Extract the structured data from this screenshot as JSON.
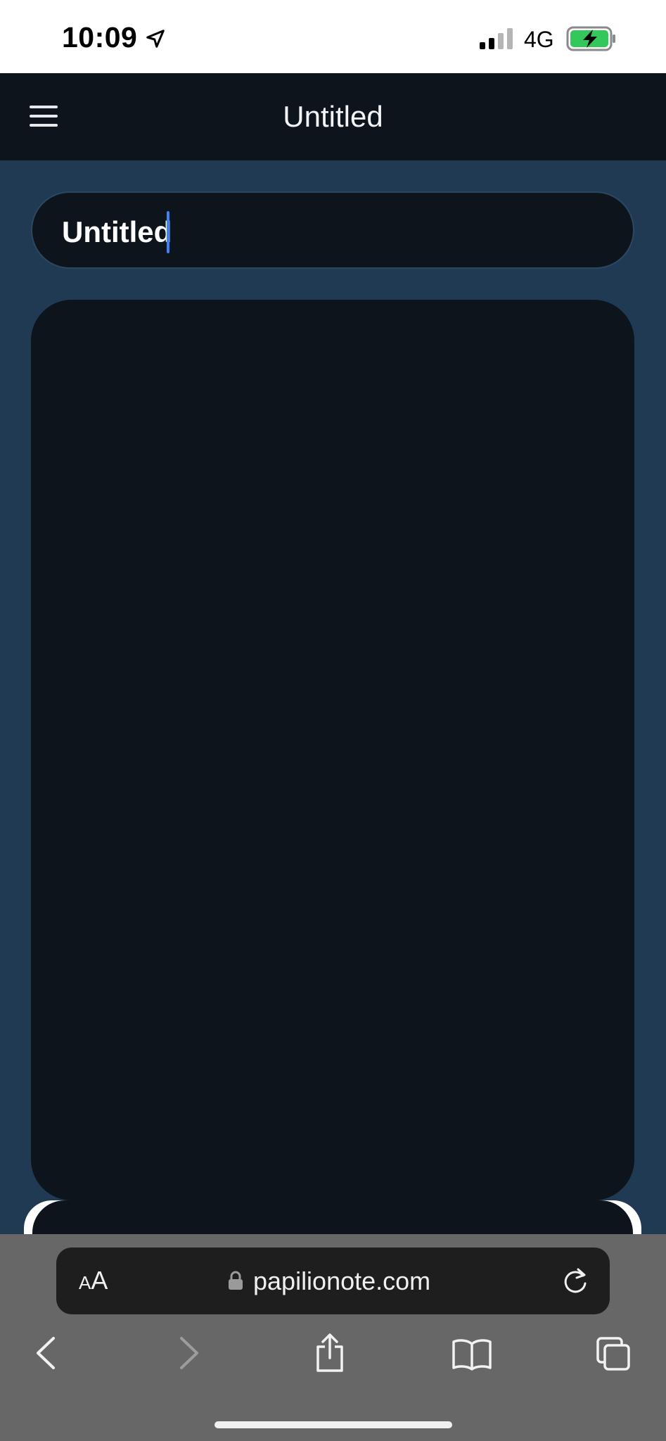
{
  "status_bar": {
    "time": "10:09",
    "network": "4G",
    "icons": [
      "location-arrow-icon",
      "cellular-signal-icon",
      "battery-charging-icon"
    ],
    "battery_color": "#34c759"
  },
  "header": {
    "title": "Untitled",
    "menu_icon": "hamburger-menu-icon"
  },
  "note": {
    "title_value": "Untitled",
    "body_value": ""
  },
  "browser": {
    "aa_small": "A",
    "aa_large": "A",
    "url": "papilionote.com",
    "icons": [
      "lock-icon",
      "reload-icon",
      "back-icon",
      "forward-icon",
      "share-icon",
      "bookmarks-icon",
      "tabs-icon"
    ]
  },
  "colors": {
    "page_background": "#1f3a52",
    "header_background": "#0d141b",
    "panel_background": "#0d141b",
    "caret": "#3b82f6",
    "browser_chrome": "#676767"
  }
}
